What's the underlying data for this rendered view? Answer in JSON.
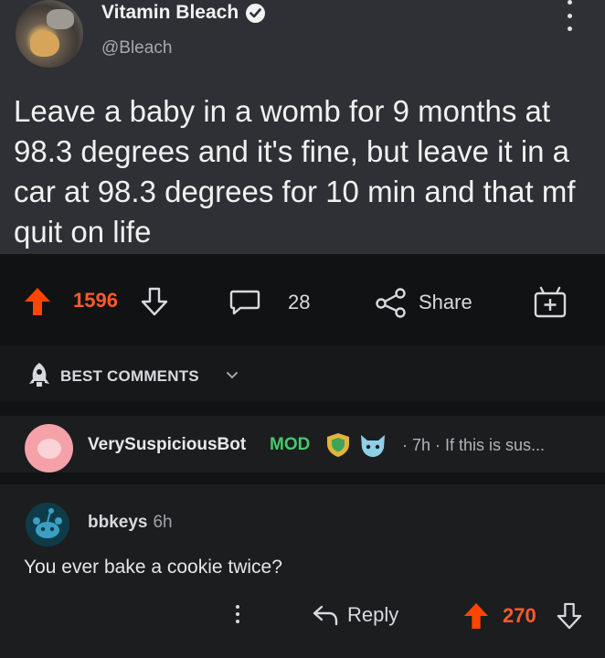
{
  "tweet": {
    "name": "Vitamin Bleach",
    "handle": "@Bleach",
    "text": "Leave a baby in a womb for 9 months at 98.3 degrees and it's fine, but leave it in a car at 98.3 degrees for 10 min and that mf quit on life"
  },
  "post_actions": {
    "upvotes": "1596",
    "comments": "28",
    "share_label": "Share"
  },
  "sort": {
    "label": "BEST COMMENTS"
  },
  "mod_comment": {
    "author": "VerySuspiciousBot",
    "badge": "MOD",
    "meta": "· 7h · If this is sus..."
  },
  "comment": {
    "author": "bbkeys",
    "time": "6h",
    "text": "You ever bake a cookie twice?",
    "reply_label": "Reply",
    "upvotes": "270"
  },
  "colors": {
    "upvote": "#ff5a2b",
    "mod": "#46c86a",
    "tweet_bg": "#2f3035"
  }
}
